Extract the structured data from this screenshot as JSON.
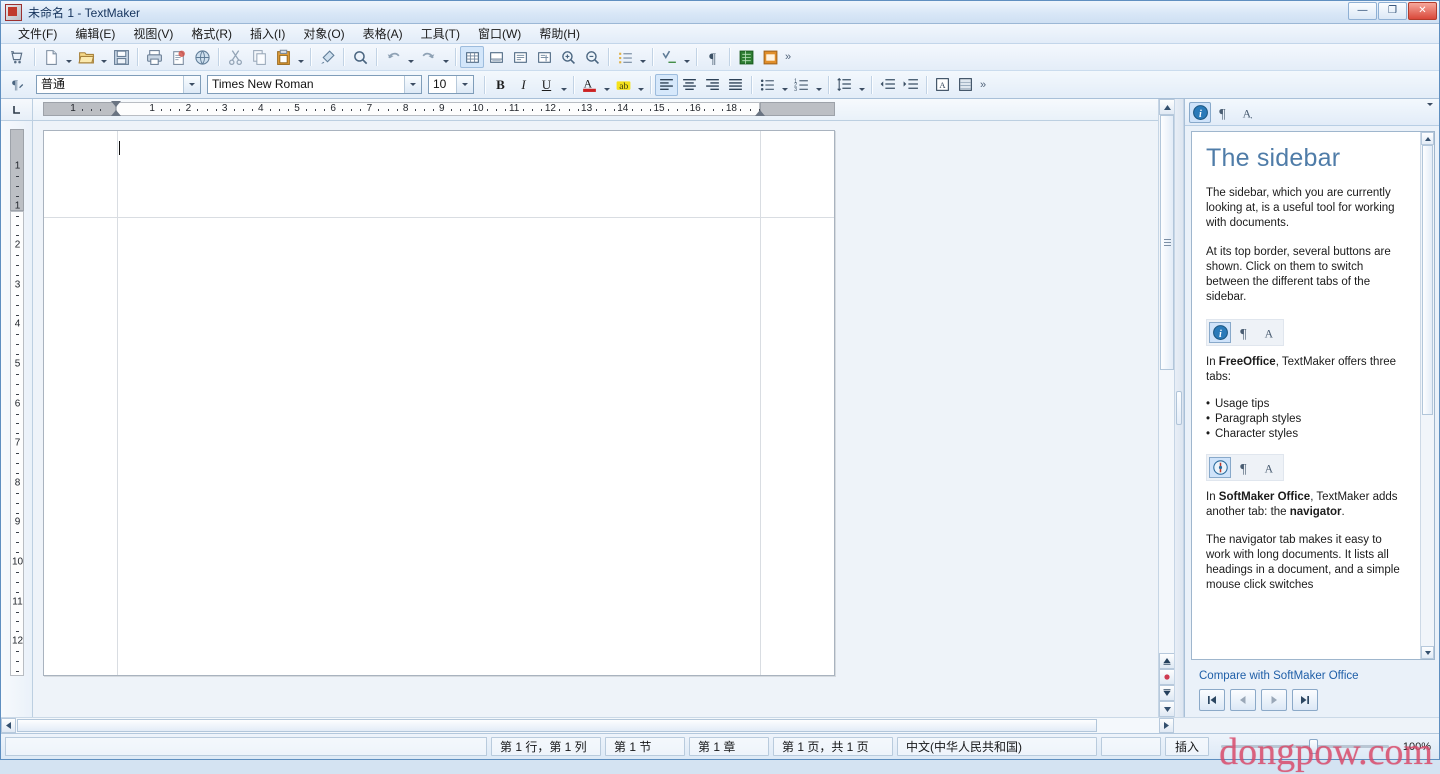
{
  "window": {
    "title": "未命名 1 - TextMaker",
    "app_icon": "textmaker-icon",
    "minimize": "—",
    "restore": "❐",
    "close": "✕"
  },
  "menubar": [
    {
      "label": "文件(F)",
      "name": "menu-file"
    },
    {
      "label": "编辑(E)",
      "name": "menu-edit"
    },
    {
      "label": "视图(V)",
      "name": "menu-view"
    },
    {
      "label": "格式(R)",
      "name": "menu-format"
    },
    {
      "label": "插入(I)",
      "name": "menu-insert"
    },
    {
      "label": "对象(O)",
      "name": "menu-object"
    },
    {
      "label": "表格(A)",
      "name": "menu-table"
    },
    {
      "label": "工具(T)",
      "name": "menu-tools"
    },
    {
      "label": "窗口(W)",
      "name": "menu-window"
    },
    {
      "label": "帮助(H)",
      "name": "menu-help"
    }
  ],
  "toolbar": {
    "more_label": "»",
    "buttons": [
      {
        "name": "document-manager-icon",
        "tip": "文档管理"
      },
      {
        "name": "new-document-icon",
        "tip": "新建"
      },
      {
        "name": "open-document-icon",
        "tip": "打开"
      },
      {
        "name": "save-document-icon",
        "tip": "保存"
      },
      {
        "name": "print-icon",
        "tip": "打印"
      },
      {
        "name": "print-preview-icon",
        "tip": "打印预览"
      },
      {
        "name": "send-mail-icon",
        "tip": "发送"
      },
      {
        "name": "cut-icon",
        "tip": "剪切"
      },
      {
        "name": "copy-icon",
        "tip": "复制"
      },
      {
        "name": "paste-icon",
        "tip": "粘贴"
      },
      {
        "name": "format-painter-icon",
        "tip": "格式刷"
      },
      {
        "name": "search-icon",
        "tip": "查找"
      },
      {
        "name": "undo-icon",
        "tip": "撤销"
      },
      {
        "name": "redo-icon",
        "tip": "重做"
      },
      {
        "name": "insert-table-icon",
        "tip": "插入表格"
      },
      {
        "name": "insert-frame-icon",
        "tip": "插入框"
      },
      {
        "name": "insert-textframe-icon",
        "tip": "文本框"
      },
      {
        "name": "insert-picture-icon",
        "tip": "图片框"
      },
      {
        "name": "zoom-in-icon",
        "tip": "放大"
      },
      {
        "name": "zoom-out-icon",
        "tip": "缩小"
      },
      {
        "name": "bullets-icon",
        "tip": "项目符号"
      },
      {
        "name": "spellcheck-icon",
        "tip": "拼写检查"
      },
      {
        "name": "show-paragraph-marks-icon",
        "tip": "显示段落标记"
      },
      {
        "name": "planmaker-icon",
        "tip": "PlanMaker"
      },
      {
        "name": "presentations-icon",
        "tip": "Presentations"
      }
    ]
  },
  "formatbar": {
    "paragraph_style_button": "paragraph-style-icon",
    "style": {
      "value": "普通",
      "name": "paragraph-style-combo"
    },
    "font": {
      "value": "Times New Roman",
      "name": "font-name-combo"
    },
    "size": {
      "value": "10",
      "name": "font-size-combo"
    },
    "bold": "B",
    "italic": "I",
    "underline": "U",
    "font_color": "A",
    "highlight": "ab",
    "align_left": "align-left-icon",
    "align_center": "align-center-icon",
    "align_right": "align-right-icon",
    "align_justify": "align-justify-icon",
    "bullet_list": "bullet-list-icon",
    "number_list": "number-list-icon",
    "line_spacing": "line-spacing-icon",
    "decrease_indent": "decrease-indent-icon",
    "increase_indent": "increase-indent-icon",
    "borders": "borders-icon",
    "shading": "shading-icon",
    "more_label": "»"
  },
  "ruler": {
    "horizontal_numbers": [
      "1",
      "1",
      "2",
      "3",
      "4",
      "5",
      "6",
      "7",
      "8",
      "9",
      "10",
      "11",
      "12",
      "13",
      "14",
      "15",
      "16",
      "18"
    ],
    "vertical_numbers": [
      "1",
      "1",
      "2",
      "3",
      "4",
      "5",
      "6",
      "7",
      "8",
      "9",
      "10",
      "11",
      "12"
    ],
    "tab_marker": "L"
  },
  "sidebar": {
    "tabs": [
      {
        "name": "sidebar-tab-usage-tips",
        "icon": "info-icon",
        "active": true
      },
      {
        "name": "sidebar-tab-paragraph-styles",
        "icon": "paragraph-mark-icon",
        "active": false
      },
      {
        "name": "sidebar-tab-character-styles",
        "icon": "character-style-icon",
        "active": false
      }
    ],
    "menu_icon": "chevron-down-icon",
    "heading": "The sidebar",
    "paragraph_1": "The sidebar, which you are currently looking at, is a useful tool for working with documents.",
    "paragraph_2": "At its top border, several buttons are shown. Click on them to switch between the different tabs of the sidebar.",
    "freeoffice_tabs": [
      {
        "name": "demo-tab-info",
        "icon": "info-icon",
        "active": true
      },
      {
        "name": "demo-tab-paragraph",
        "icon": "paragraph-mark-icon",
        "active": false
      },
      {
        "name": "demo-tab-character",
        "icon": "character-style-icon",
        "active": false
      }
    ],
    "freeoffice_intro_pre": "In ",
    "freeoffice_name": "FreeOffice",
    "freeoffice_intro_post": ", TextMaker offers three tabs:",
    "freeoffice_list": [
      "Usage tips",
      "Paragraph styles",
      "Character styles"
    ],
    "softmaker_tabs": [
      {
        "name": "demo-tab-navigator",
        "icon": "navigator-icon",
        "active": true
      },
      {
        "name": "demo-tab-paragraph-2",
        "icon": "paragraph-mark-icon",
        "active": false
      },
      {
        "name": "demo-tab-character-2",
        "icon": "character-style-icon",
        "active": false
      }
    ],
    "softmaker_intro_pre": "In ",
    "softmaker_name": "SoftMaker Office",
    "softmaker_intro_mid": ", TextMaker adds another tab: the ",
    "softmaker_bold_tail": "navigator",
    "softmaker_intro_post": ".",
    "paragraph_3": "The navigator tab makes it easy to work with long documents. It lists all headings in a document, and a simple mouse click switches",
    "link": "Compare with SoftMaker Office",
    "nav_first": "⏮",
    "nav_prev": "◀",
    "nav_next": "▶",
    "nav_last": "⏭"
  },
  "statusbar": {
    "cells": [
      {
        "name": "status-cursor-position",
        "label": "第 1 行，第 1 列"
      },
      {
        "name": "status-section",
        "label": "第 1 节"
      },
      {
        "name": "status-chapter",
        "label": "第 1 章"
      },
      {
        "name": "status-page",
        "label": "第 1 页，共 1 页"
      },
      {
        "name": "status-language",
        "label": "中文(中华人民共和国)"
      }
    ],
    "insert_mode": "插入",
    "zoom_value": "100%",
    "watermark": "dongpow.com"
  },
  "colors": {
    "accent": "#4f7ca8",
    "link": "#1f5fa8",
    "watermark": "#d94a6a",
    "titlebar": "#15335c"
  }
}
